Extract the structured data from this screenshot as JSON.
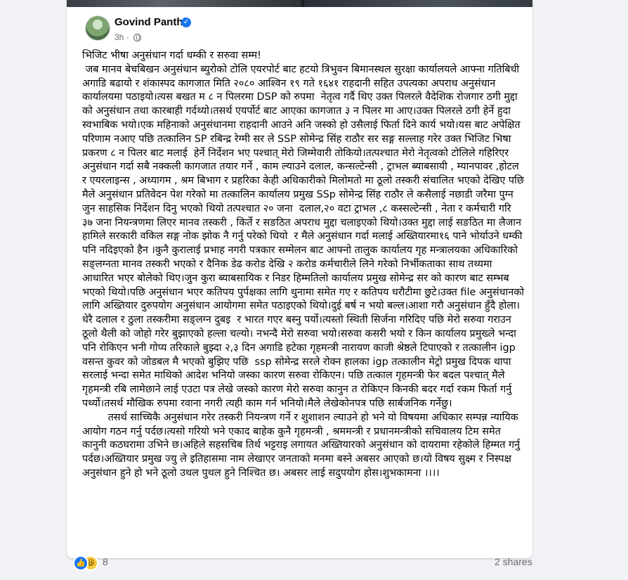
{
  "post": {
    "author": "Govind Panthi",
    "verified_icon": "✓",
    "timestamp": "3h",
    "audience_icon": "globe-icon",
    "body": "भिजिट भीषा अनुसंधान गर्दा धम्की र सरुवा सम्म!\n जब मानव बेचबिखन अनुसंधान ब्युरोको टोलि एयरपोर्ट बाट हटयो त्रिभुवन बिमानस्थल सुरक्षा कार्यालयले आफ्ना गतिबिधी अगाडि बढायो र शंकास्पद कागजात मिति २०८० आश्विन १९ गते १६४१ राहदानी सहित उपत्यका अपराध अनुसंधान कार्यालयमा पठाइयो।त्यस बखत म ८ न पिलरमा DSP को रुपमा  नेतृत्व गर्दै थिए उक्त पिलरले वैदेशिक रोजगार ठगी मुद्दा को अनुसंधान तथा कारबाही गर्दथ्यो।तसर्थ एयर्पोर्ट बाट आएका कागजात ३ न पिलर मा आए।उक्त पिलरले ठगी हेर्ने हुदा स्वभाबिक भयो।एक महिनाको अनुसंधानमा राहदानी आउने अनि जस्को हो उसैलाई फिर्ता दिने कार्य भयो।यस बाट अपेक्षित परिणाम नआए पछि तत्कालिन SP रबिन्द्र रेग्मी सर ले SSP सोमेन्द्र सिंह राठौर सर सङ्ग सल्लाह गरेर उक्त भिजिट भिषा प्रकरण ८ न पिलर बाट मलाई  हेर्ने निर्देशन भए पश्चात् मेरो जिम्मेवारी तोकियो।तत्पश्चात मेरो नेतृत्वको टोलिले गहिरिएर अनुसंधान गर्दा सबै नक्कली कागजात तयार गर्ने , काम ल्याउने दलाल, कन्सल्टेन्सी , ट्राभल ब्याबसायी , म्यानपावर ,होटल र एयरलाइन्स , अध्यागम , श्रम बिभाग र प्रहरिका केही अधिकारीको मिलोमतो मा ठूलो तस्करी संचालित भएको देखिए पछि मैले अनुसंधान प्रतिवेदन पेश गरेको मा तत्कालिन कार्यालय प्रमुख SSp सोमेन्द्र सिंह राठौर ले कसैलाई नछाडी जरैमा पुग्न जुन साहसिक निर्देशन दिनु भएको थियो तत्पश्चात २० जना  दलाल,२० वटा ट्राभल ,८ कस्सल्टेन्सी , नेता र कर्मचारी गरि ३७ जना नियन्त्रणमा लिएर मानव तस्करी , किर्ते र सङठित अपराध मुद्दा चलाइएको थियो।उक्त मुद्दा लाई सङठित मा लैजान हामिले सरकारी वकिल सङ्ग नोक झोक नै गर्नु परेको थियो  र मैले अनुसंधान गर्दा मलाई अख्तियारमा१६ पाने भोर्याउने धम्की पनि नदिइएको हैन ।कुनै कुरालाई प्रभाह नगरी पत्रकार सम्मेलन बाट आफ्नो तालुक कार्यालय गृह मन्त्रालयका अधिकारिको सङ्लग्नता मानव तस्करी भएको र दैनिक डेढ करोड देखि २ करोड कर्मचारीले लिने गरेको निर्भीकताका साथ तथ्यमा आधारित भएर बोलेको थिए।जुन कुरा ब्याबसायिक र निडर हिम्मतिलो कार्यालय प्रमुख सोमेन्द्र सर को कारण बाट सम्भब भएको थियो।पछि अनुसंधान भएर कतिपय पुर्पक्षका लागि थुनामा समेत गए र कतिपय धरौटीमा छुटे।उक्त file अनुसंधानको लागि अख्तियार दुरुपयोग अनुसंधान आयोगमा समेत पठाइएको थियो।दुई बर्ष न भयो बल्ल।आशा गरौ अनुसंधान हुँदै होला। धेरै दलाल र ठुला तस्करीमा सङ्लग्न दुबइ  र भारत गएर बस्नु पर्यो।त्यस्तो स्थिती सिर्जना गरिदिए पछि मेरो सरुवा गराउन ठूलो थैली को जोहो गरेर बुझाएको हल्ला चल्यो। नभन्दै मेरो सरुवा भयो।सरुवा कसरी भयो र किन कार्यालय प्रमुख्ले भन्दा पनि रोकिएन भनी गोप्य तरिकाले बुझ्दा २,३ दिन अगाडि हटेका गृहमन्त्री नारायण काजी श्रेष्ठले टिपाएको र तत्कालीन igp वसन्त कुवर को जोडबल मै भएको बुझिए पछि  ssp सोमेन्द्र सरले रोक्न हालका igp तत्कालीन मेट्रो प्रमुख दिपक थापा सरलाई भन्दा समेत माथिको आदेश भनियो जस्का कारण सरुवा रोकिएन। पछि तत्काल गृहमन्त्री फेर बदल पश्चात् मैले गृहमन्त्री रबि लामेछाने लाई एउटा पत्र लेखे जस्को कारण मेरो सरुवा कानुन त रोकिएन किनकी बदर गर्दा रकम फिर्ता गर्नु पर्थ्यो।तसर्थ मौखिक रुपमा रवाना नगरी त्यही काम गर्न भनियो।मैले लेखेकोनपत्र पछि सार्बजनिक गर्नेछु।\n        तसर्थ साच्चिकै अनुसंधान गरेर तस्करी नियन्त्रण गर्ने र शुशाशन ल्याउने हो भने यो विषयमा अधिकार सम्पन्न न्यायिक आयोग गठन गर्नु पर्दछ।त्यसो गरियो भने एकाद बाहेक कुनै गृहमन्त्री , श्रममन्त्री र प्रधानमन्त्रीको सचिवालय टिम समेत कानुनी कठघरामा उभिने छ।अहिले सहसचिब तिर्थ भट्टराइ लगायत अख्तियारको अनुसंधान को दायरामा रहेकोले हिम्मत गर्नु पर्दछ।अख्तियार प्रमुख ज्यु ले इतिहासमा नाम लेखाएर जनताको मनमा बस्ने अबसर आएको छ।यो विषय सुक्ष्म र निस्पक्ष अनुसंधान हुने हो भने ठूलो उथल पुथल हुने निश्चित छ। अबसर लाई सदुपयोग होस।शुभकामना ।।।।"
  },
  "reactions": {
    "count": "8",
    "like_icon": "👍",
    "haha_icon": "😆"
  },
  "shares": "2 shares",
  "menu_icon": "···"
}
